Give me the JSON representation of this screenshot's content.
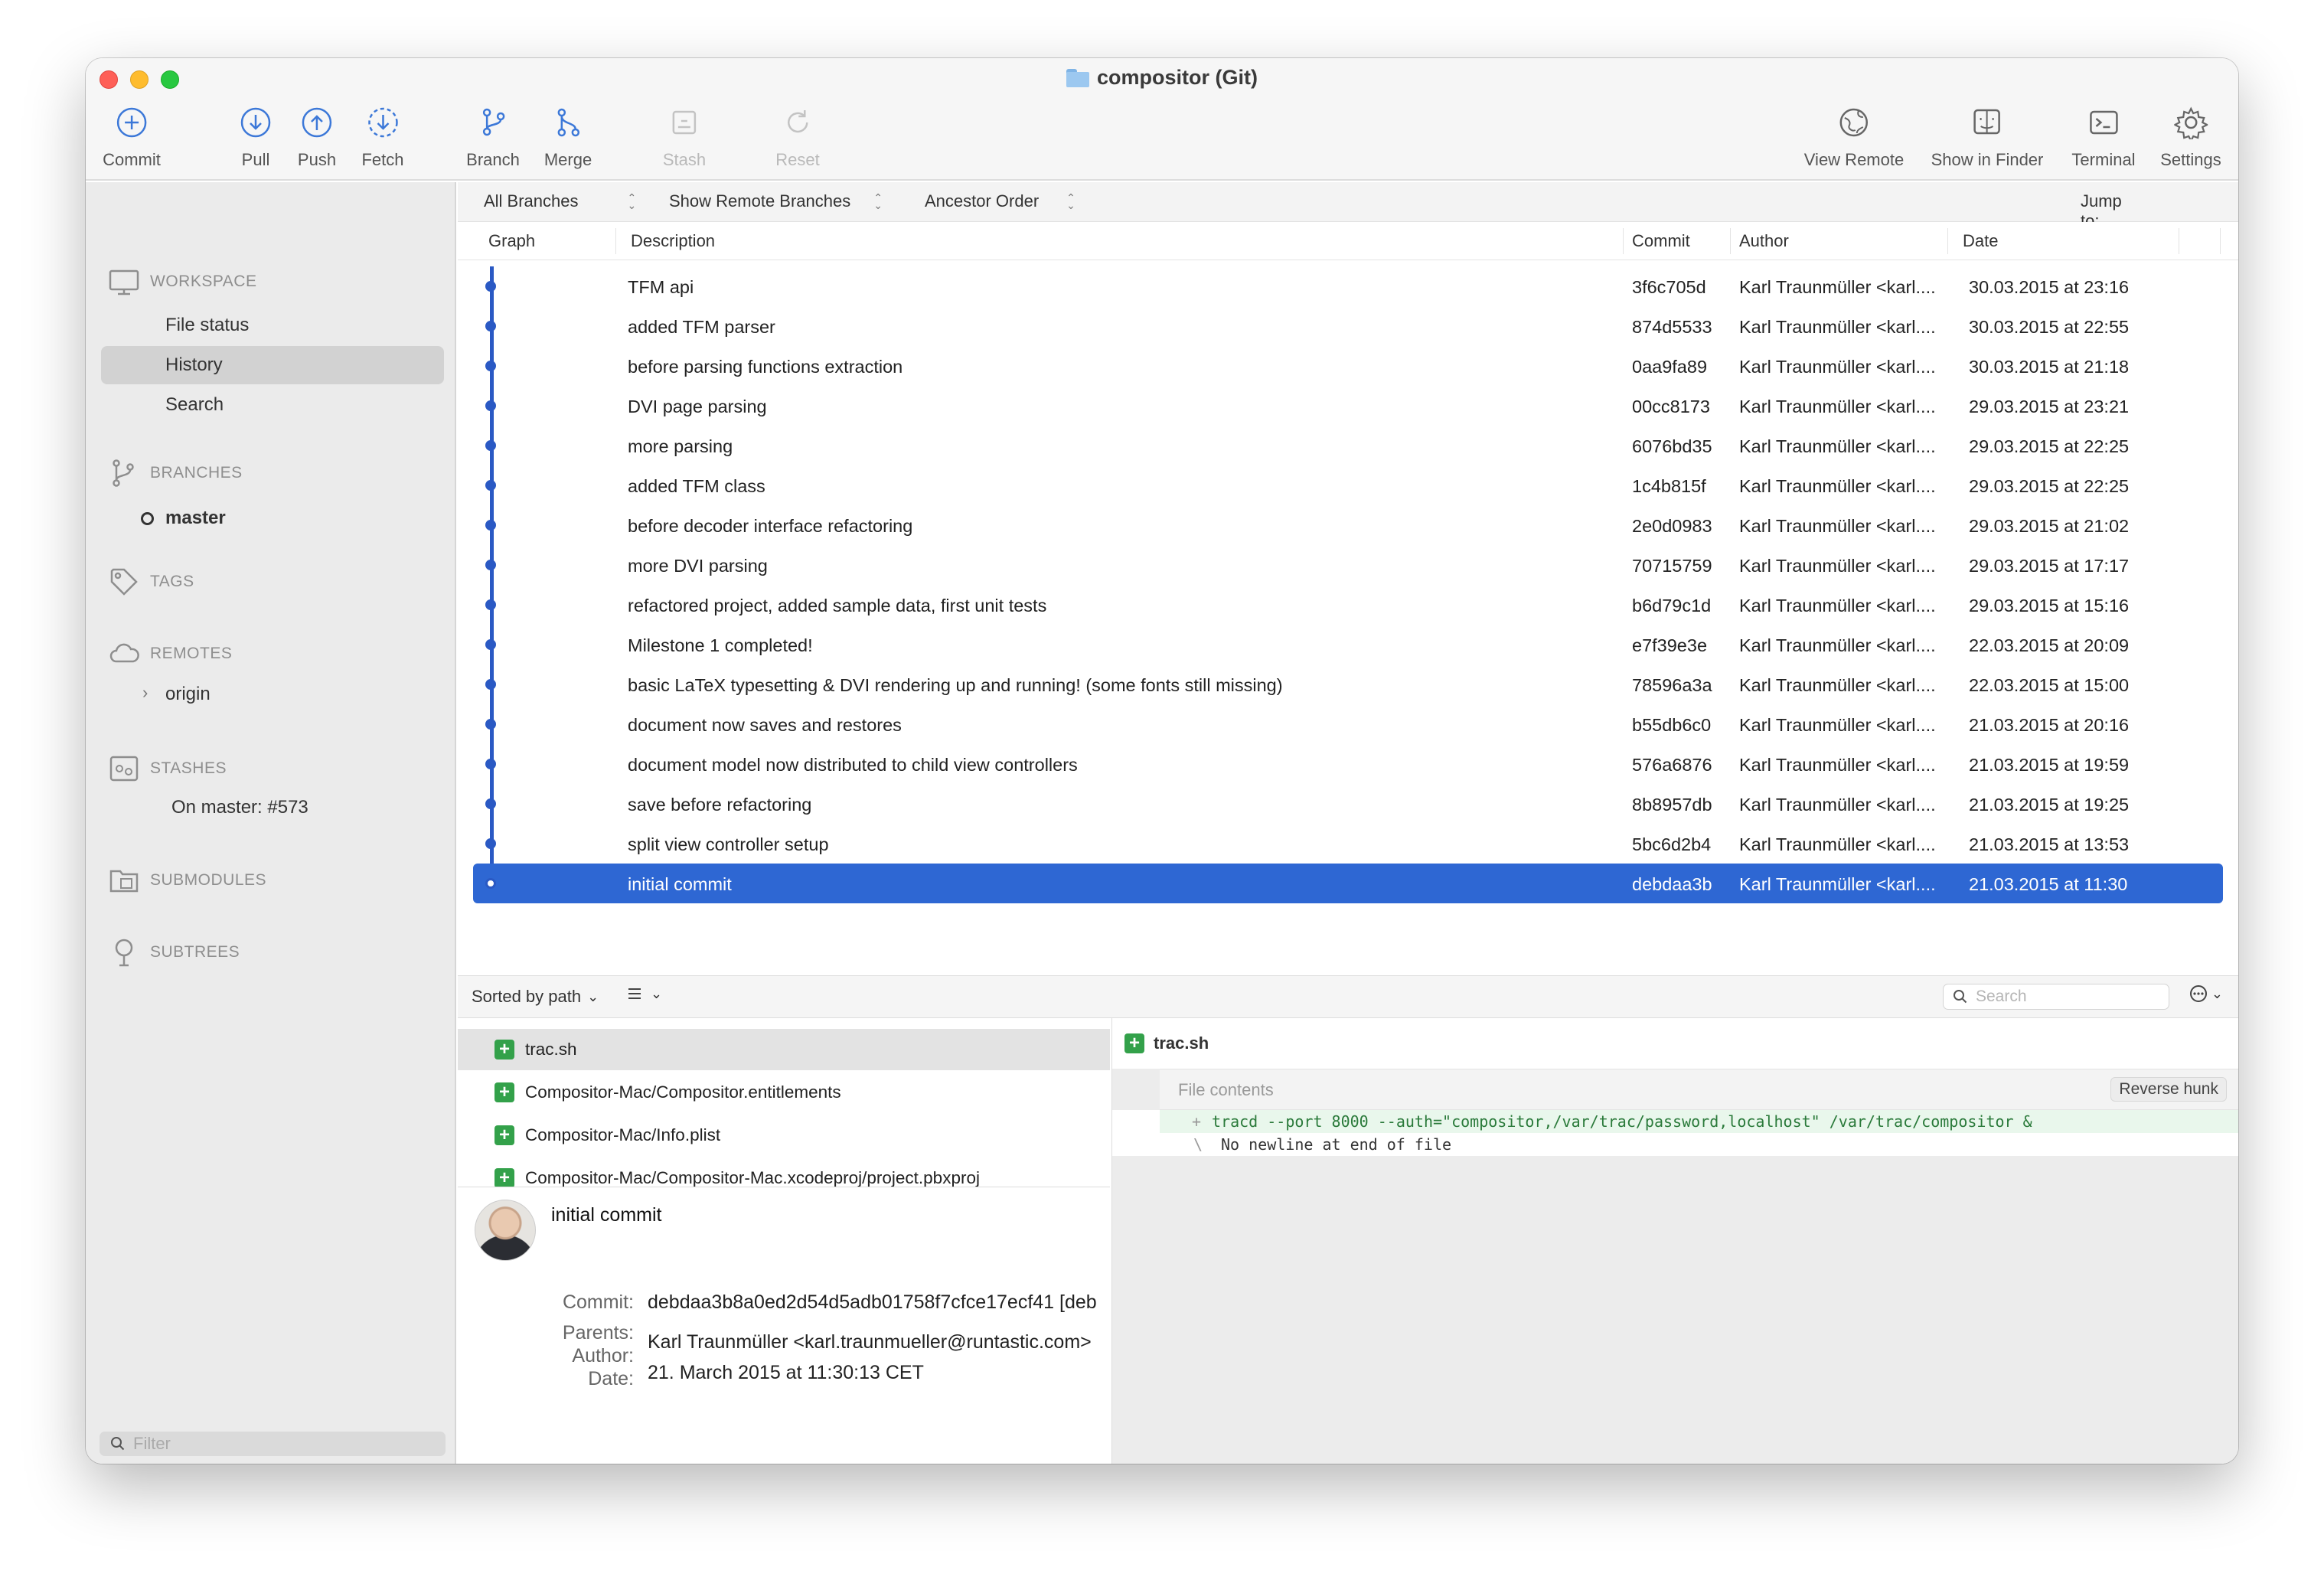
{
  "window": {
    "title": "compositor (Git)"
  },
  "toolbar": {
    "commit": "Commit",
    "pull": "Pull",
    "push": "Push",
    "fetch": "Fetch",
    "branch": "Branch",
    "merge": "Merge",
    "stash": "Stash",
    "reset": "Reset",
    "view_remote": "View Remote",
    "show_in_finder": "Show in Finder",
    "terminal": "Terminal",
    "settings": "Settings"
  },
  "sidebar": {
    "workspace": "WORKSPACE",
    "file_status": "File status",
    "history": "History",
    "search": "Search",
    "branches": "BRANCHES",
    "master": "master",
    "tags": "TAGS",
    "remotes": "REMOTES",
    "origin": "origin",
    "stashes": "STASHES",
    "stash_item": "On master: #573",
    "submodules": "SUBMODULES",
    "subtrees": "SUBTREES",
    "filter_placeholder": "Filter"
  },
  "filterbar": {
    "branches": "All Branches",
    "remote": "Show Remote Branches",
    "order": "Ancestor Order",
    "jump": "Jump to:"
  },
  "columns": {
    "graph": "Graph",
    "description": "Description",
    "commit": "Commit",
    "author": "Author",
    "date": "Date"
  },
  "commits": [
    {
      "description": "TFM api",
      "commit": "3f6c705d",
      "author": "Karl Traunmüller <karl....",
      "date": "30.03.2015 at 23:16"
    },
    {
      "description": "added TFM parser",
      "commit": "874d5533",
      "author": "Karl Traunmüller <karl....",
      "date": "30.03.2015 at 22:55"
    },
    {
      "description": "before parsing functions extraction",
      "commit": "0aa9fa89",
      "author": "Karl Traunmüller <karl....",
      "date": "30.03.2015 at 21:18"
    },
    {
      "description": "DVI page parsing",
      "commit": "00cc8173",
      "author": "Karl Traunmüller <karl....",
      "date": "29.03.2015 at 23:21"
    },
    {
      "description": "more parsing",
      "commit": "6076bd35",
      "author": "Karl Traunmüller <karl....",
      "date": "29.03.2015 at 22:25"
    },
    {
      "description": "added TFM class",
      "commit": "1c4b815f",
      "author": "Karl Traunmüller <karl....",
      "date": "29.03.2015 at 22:25"
    },
    {
      "description": "before decoder interface refactoring",
      "commit": "2e0d0983",
      "author": "Karl Traunmüller <karl....",
      "date": "29.03.2015 at 21:02"
    },
    {
      "description": "more DVI parsing",
      "commit": "70715759",
      "author": "Karl Traunmüller <karl....",
      "date": "29.03.2015 at 17:17"
    },
    {
      "description": "refactored project, added sample data, first unit tests",
      "commit": "b6d79c1d",
      "author": "Karl Traunmüller <karl....",
      "date": "29.03.2015 at 15:16"
    },
    {
      "description": "Milestone 1 completed!",
      "commit": "e7f39e3e",
      "author": "Karl Traunmüller <karl....",
      "date": "22.03.2015 at 20:09"
    },
    {
      "description": "basic LaTeX typesetting & DVI rendering up and running! (some fonts still missing)",
      "commit": "78596a3a",
      "author": "Karl Traunmüller <karl....",
      "date": "22.03.2015 at 15:00"
    },
    {
      "description": "document now saves and restores",
      "commit": "b55db6c0",
      "author": "Karl Traunmüller <karl....",
      "date": "21.03.2015 at 20:16"
    },
    {
      "description": "document model now distributed to child view controllers",
      "commit": "576a6876",
      "author": "Karl Traunmüller <karl....",
      "date": "21.03.2015 at 19:59"
    },
    {
      "description": "save before refactoring",
      "commit": "8b8957db",
      "author": "Karl Traunmüller <karl....",
      "date": "21.03.2015 at 19:25"
    },
    {
      "description": "split view controller setup",
      "commit": "5bc6d2b4",
      "author": "Karl Traunmüller <karl....",
      "date": "21.03.2015 at 13:53"
    },
    {
      "description": "initial commit",
      "commit": "debdaa3b",
      "author": "Karl Traunmüller <karl....",
      "date": "21.03.2015 at 11:30"
    }
  ],
  "midbar": {
    "sort": "Sorted by path",
    "search_placeholder": "Search"
  },
  "files": [
    "trac.sh",
    "Compositor-Mac/Compositor.entitlements",
    "Compositor-Mac/Info.plist",
    "Compositor-Mac/Compositor-Mac.xcodeproj/project.pbxproj"
  ],
  "details": {
    "subject": "initial commit",
    "commit_label": "Commit:",
    "commit_value": "debdaa3b8a0ed2d54d5adb01758f7cfce17ecf41 [deb",
    "parents_label": "Parents:",
    "author_label": "Author:",
    "author_value": "Karl Traunmüller <karl.traunmueller@runtastic.com>",
    "date_label": "Date:",
    "date_value": "21. March 2015 at 11:30:13 CET"
  },
  "diff": {
    "file": "trac.sh",
    "hunk_title": "File contents",
    "reverse_hunk": "Reverse hunk",
    "add_marker": "+",
    "line1": "tracd --port 8000 --auth=\"compositor,/var/trac/password,localhost\" /var/trac/compositor &",
    "nl_marker": "\\",
    "line2": "No newline at end of file"
  },
  "colors": {
    "accent": "#2e67d3",
    "graph": "#2a59c4",
    "added": "#33a14a"
  }
}
